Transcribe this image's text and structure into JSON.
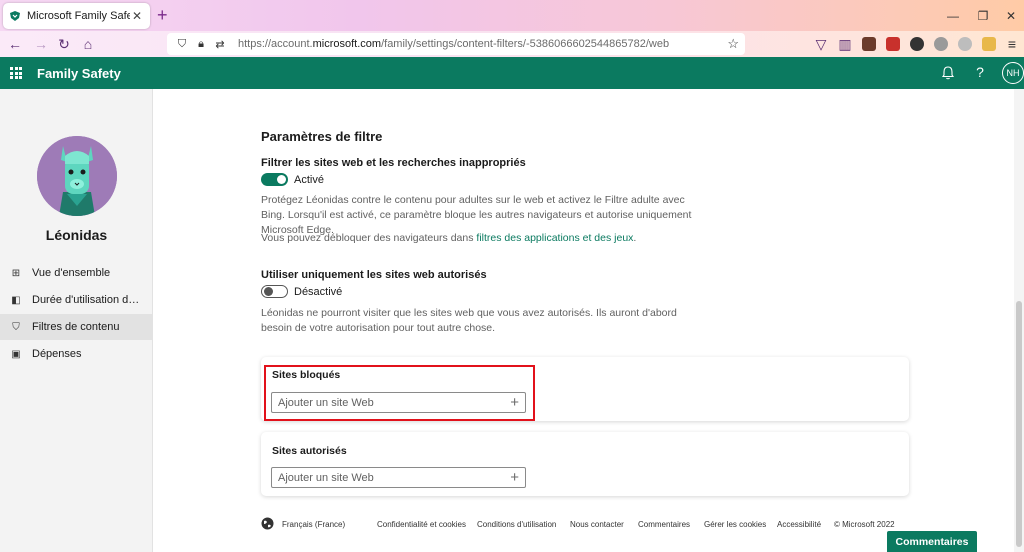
{
  "browser": {
    "tab_title": "Microsoft Family Safety",
    "tab_close": "✕",
    "new_tab": "+",
    "url_prefix": "https://account.",
    "url_domain": "microsoft.com",
    "url_path": "/family/settings/content-filters/-5386066602544865782/web",
    "window_controls": [
      "—",
      "❐",
      "✕"
    ]
  },
  "app": {
    "title": "Family Safety",
    "user_initials": "NH",
    "help_icon": "?",
    "accent_color": "#0b7a60"
  },
  "sidebar": {
    "child_name": "Léonidas",
    "items": [
      {
        "label": "Vue d'ensemble",
        "icon": "overview-icon"
      },
      {
        "label": "Durée d'utilisation des a...",
        "icon": "screen-time-icon"
      },
      {
        "label": "Filtres de contenu",
        "icon": "shield-icon",
        "active": true
      },
      {
        "label": "Dépenses",
        "icon": "spending-icon"
      }
    ]
  },
  "main": {
    "section_title": "Paramètres de filtre",
    "filter_heading": "Filtrer les sites web et les recherches inappropriés",
    "filter_toggle_label": "Activé",
    "filter_on": true,
    "filter_desc": "Protégez Léonidas contre le contenu pour adultes sur le web et activez le Filtre adulte avec Bing. Lorsqu'il est activé, ce paramètre bloque les autres navigateurs et autorise uniquement Microsoft Edge.",
    "unblock_text": "Vous pouvez débloquer des navigateurs dans ",
    "unblock_link": "filtres des applications et des jeux",
    "unblock_end": ".",
    "allowed_only_heading": "Utiliser uniquement les sites web autorisés",
    "allowed_only_toggle_label": "Désactivé",
    "allowed_only_on": false,
    "allowed_only_desc": "Léonidas ne pourront visiter que les sites web que vous avez autorisés. Ils auront d'abord besoin de votre autorisation pour tout autre chose.",
    "blocked_card": {
      "title": "Sites bloqués",
      "placeholder": "Ajouter un site Web"
    },
    "allowed_card": {
      "title": "Sites autorisés",
      "placeholder": "Ajouter un site Web"
    }
  },
  "footer": {
    "language": "Français (France)",
    "links": [
      "Confidentialité et cookies",
      "Conditions d'utilisation",
      "Nous contacter",
      "Commentaires",
      "Gérer les cookies",
      "Accessibilité",
      "© Microsoft 2022"
    ],
    "feedback_button": "Commentaires"
  }
}
